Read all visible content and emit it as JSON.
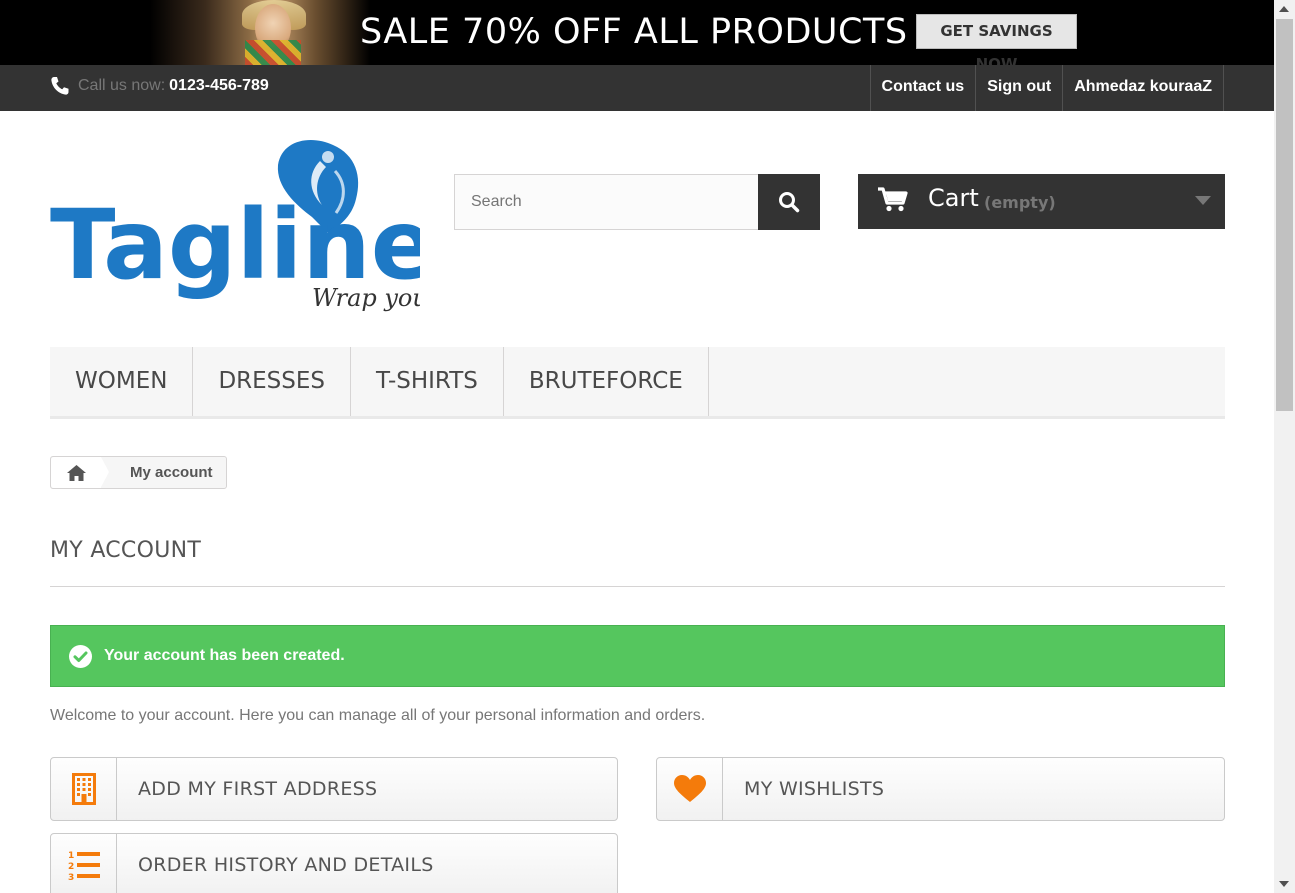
{
  "banner": {
    "headline": "SALE 70% OFF ALL PRODUCTS",
    "cta": "GET SAVINGS NOW"
  },
  "topbar": {
    "call_label": "Call us now:",
    "phone": "0123-456-789",
    "links": [
      "Contact us",
      "Sign out",
      "Ahmedaz kouraaZ"
    ]
  },
  "logo": {
    "name": "Tagline",
    "tagline": "Wrap you"
  },
  "search": {
    "placeholder": "Search"
  },
  "cart": {
    "label": "Cart",
    "status": "(empty)"
  },
  "menu": [
    "WOMEN",
    "DRESSES",
    "T-SHIRTS",
    "BRUTEFORCE"
  ],
  "breadcrumb": {
    "current": "My account"
  },
  "page": {
    "title": "MY ACCOUNT",
    "alert": "Your account has been created.",
    "intro": "Welcome to your account. Here you can manage all of your personal information and orders."
  },
  "account_links": [
    "ADD MY FIRST ADDRESS",
    "MY WISHLISTS",
    "ORDER HISTORY AND DETAILS"
  ],
  "colors": {
    "logo_blue": "#1e79c5",
    "accent_orange": "#f47b0b",
    "success_green": "#55c65e",
    "dark": "#333333"
  }
}
